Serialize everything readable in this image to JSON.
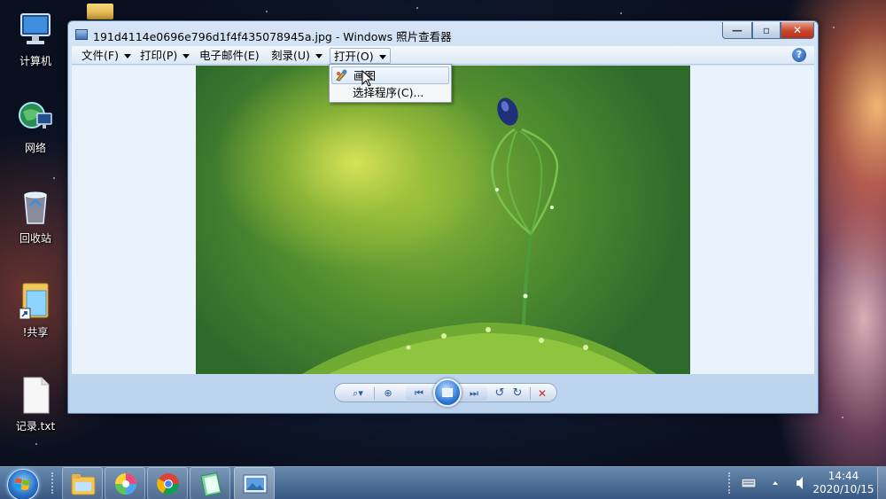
{
  "desktop": {
    "icons": [
      {
        "label": "计算机",
        "icon": "computer-icon"
      },
      {
        "label": "网络",
        "icon": "network-icon"
      },
      {
        "label": "回收站",
        "icon": "recycle-bin-icon"
      },
      {
        "label": "!共享",
        "icon": "shared-folder-shortcut-icon"
      },
      {
        "label": "记录.txt",
        "icon": "text-file-icon"
      }
    ]
  },
  "window": {
    "title": "191d4114e0696e796d1f4f435078945a.jpg - Windows 照片查看器",
    "controls": {
      "minimize": "—",
      "maximize": "▫",
      "close": "✕"
    },
    "menu": [
      {
        "label": "文件(F)",
        "has_arrow": true
      },
      {
        "label": "打印(P)",
        "has_arrow": true
      },
      {
        "label": "电子邮件(E)",
        "has_arrow": false
      },
      {
        "label": "刻录(U)",
        "has_arrow": true
      },
      {
        "label": "打开(O)",
        "has_arrow": true,
        "active": true
      }
    ],
    "help": "?",
    "open_menu": {
      "items": [
        {
          "label": "画图",
          "icon": "paint-icon",
          "highlighted": true
        },
        {
          "label": "选择程序(C)...",
          "icon": ""
        }
      ]
    },
    "controlbar": {
      "zoom": "⌕▾",
      "fit": "⊕",
      "prev": "⏮",
      "next": "⏭",
      "rotate_ccw": "↺",
      "rotate_cw": "↻",
      "delete": "✕"
    }
  },
  "taskbar": {
    "pinned": [
      "file-explorer-icon",
      "photo-app-icon",
      "chrome-icon",
      "notepad-icon",
      "photo-viewer-icon"
    ],
    "clock_time": "14:44",
    "clock_date": "2020/10/15"
  }
}
